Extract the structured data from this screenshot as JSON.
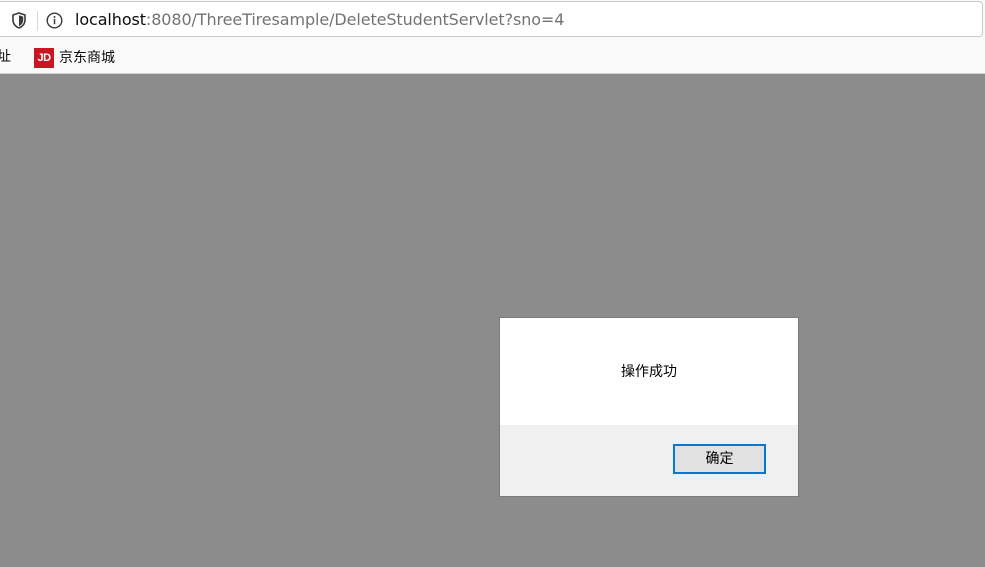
{
  "address_bar": {
    "url_host": "localhost",
    "url_rest": ":8080/ThreeTiresample/DeleteStudentServlet?sno=4"
  },
  "bookmarks": {
    "items": [
      {
        "label": "址"
      },
      {
        "icon": "jd-logo-icon",
        "icon_text": "JD",
        "label": "京东商城",
        "icon_color": "#c81623"
      }
    ]
  },
  "dialog": {
    "message": "操作成功",
    "ok_label": "确定",
    "accent": "#0078d7"
  },
  "colors": {
    "overlay": "#8c8c8c",
    "toolbar": "#f9f9fa"
  }
}
